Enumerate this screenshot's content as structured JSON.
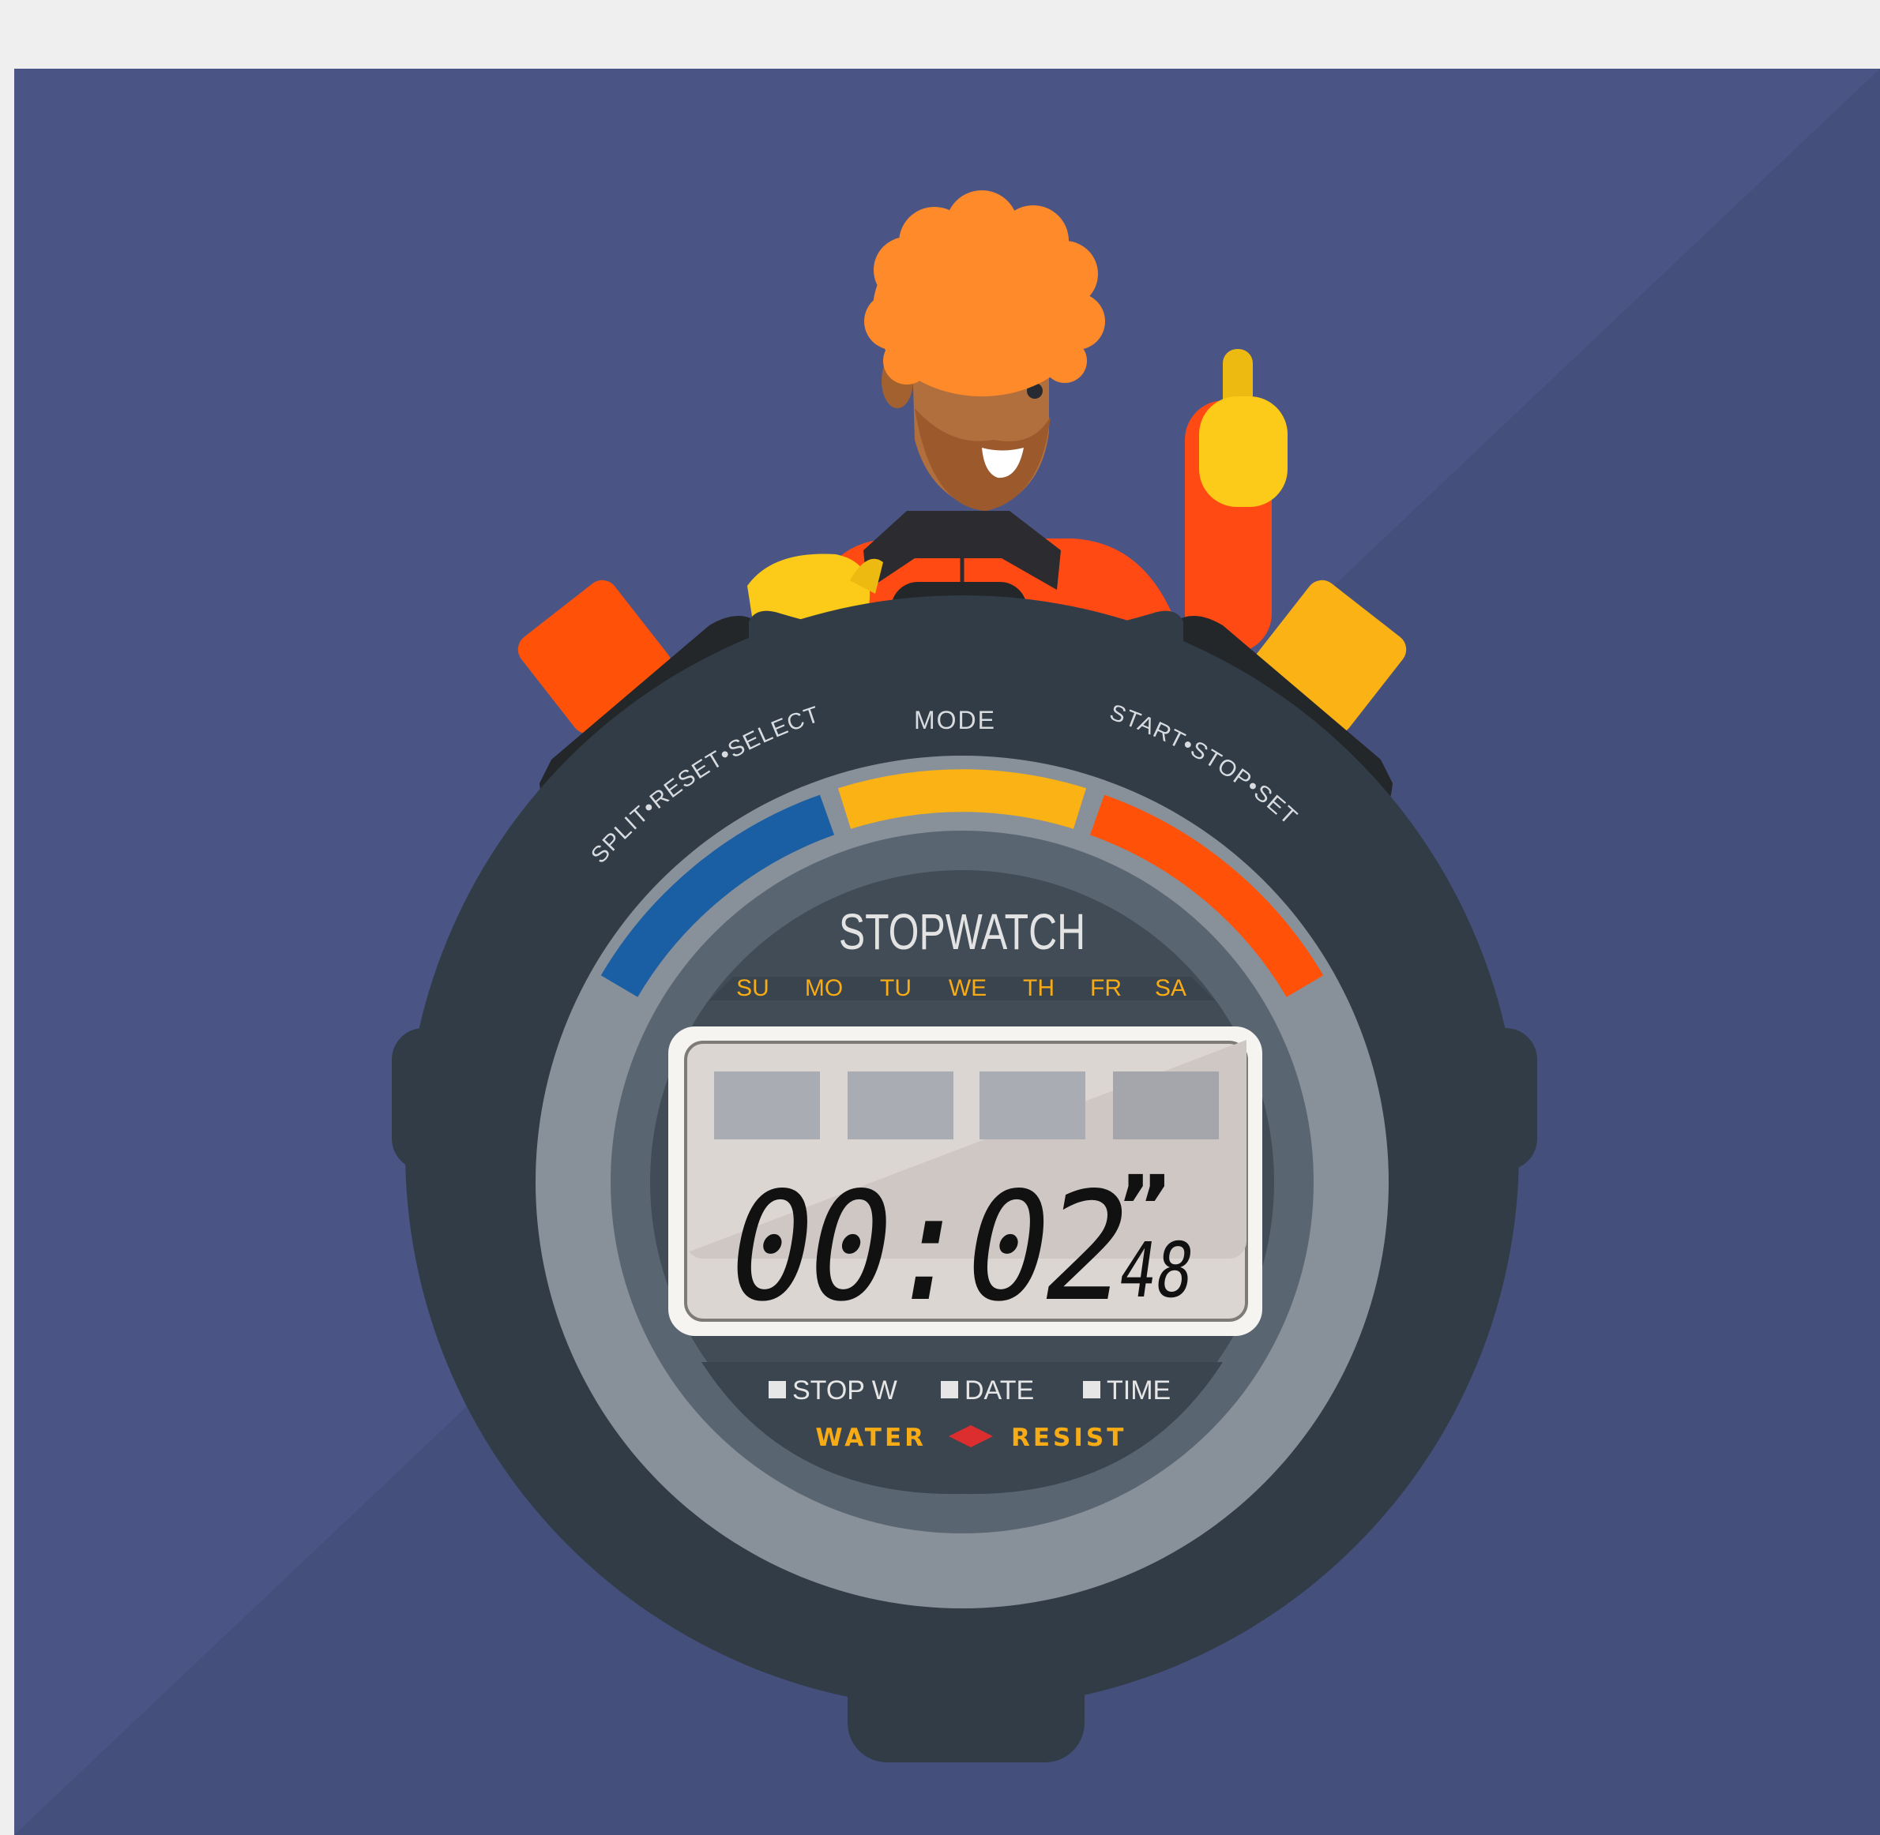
{
  "watch": {
    "mode_label": "MODE",
    "left_arc_label": "SPLIT•RESET•SELECT",
    "right_arc_label": "START•STOP•SET",
    "brand": "STOPWATCH",
    "days": [
      "SU",
      "MO",
      "TU",
      "WE",
      "TH",
      "FR",
      "SA"
    ],
    "display": {
      "main_time": "00:02",
      "second_mark": "”",
      "hundredths": "48"
    },
    "modes": [
      "STOP W",
      "DATE",
      "TIME"
    ],
    "water_label": "WATER",
    "resist_label": "RESIST"
  },
  "icons": {
    "left_button": "triangle-left-icon",
    "right_button": "triangle-right-icon",
    "mode_button": "triangle-down-icon"
  },
  "colors": {
    "background": "#4b5585",
    "case": "#313c47",
    "bezel_ring": "#88909a",
    "face": "#596672",
    "inner_face": "#414c57",
    "lcd": "#dcd6d3",
    "arc_blue": "#1a5fa3",
    "arc_yellow": "#fbb214",
    "arc_orange": "#ff5208",
    "label_yellow": "#f7ab15",
    "diamond_red": "#dc2e2e",
    "hair": "#ff8a2a",
    "skin": "#b26f3e",
    "gloves": "#fcca18"
  }
}
